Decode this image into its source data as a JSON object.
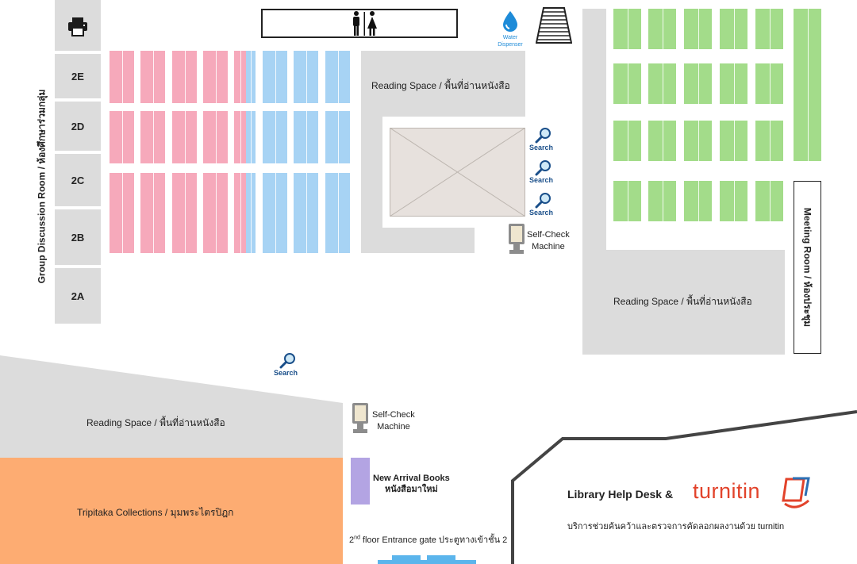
{
  "rooms": {
    "group_room_label": "Group Discussion Room / ห้องศึกษาร่วมกลุ่ม",
    "items": [
      "2E",
      "2D",
      "2C",
      "2B",
      "2A"
    ]
  },
  "amenities": {
    "water_label_1": "Water",
    "water_label_2": "Dispenser"
  },
  "reading_spaces": {
    "center": "Reading Space / พื้นที่อ่านหนังสือ",
    "right": "Reading Space / พื้นที่อ่านหนังสือ",
    "left_bottom": "Reading Space / พื้นที่อ่านหนังสือ"
  },
  "search_label": "Search",
  "self_check": {
    "line1": "Self-Check",
    "line2": "Machine"
  },
  "meeting_room": "Meeting Room / ห้องประชุม",
  "new_arrival": {
    "line1": "New Arrival Books",
    "line2": "หนังสือมาใหม่"
  },
  "tripitaka": "Tripitaka Collections  / มุมพระไตรปิฎก",
  "entrance": {
    "number": "2",
    "superscript": "nd",
    "text": "floor Entrance gate  ประตูทางเข้าชั้น 2"
  },
  "help_desk": {
    "title": "Library Help Desk  &",
    "brand": "turnitin",
    "subtitle": "บริการช่วยค้นคว้าและตรวจการคัดลอกผลงานด้วย turnitin"
  },
  "colors": {
    "pink_shelf": "#f6a9bb",
    "blue_shelf": "#a7d3f4",
    "green_shelf": "#a3dc8a",
    "tripitaka": "#fdac72",
    "new_arrival": "#b3a4e3",
    "turnitin_red": "#e2432b"
  }
}
